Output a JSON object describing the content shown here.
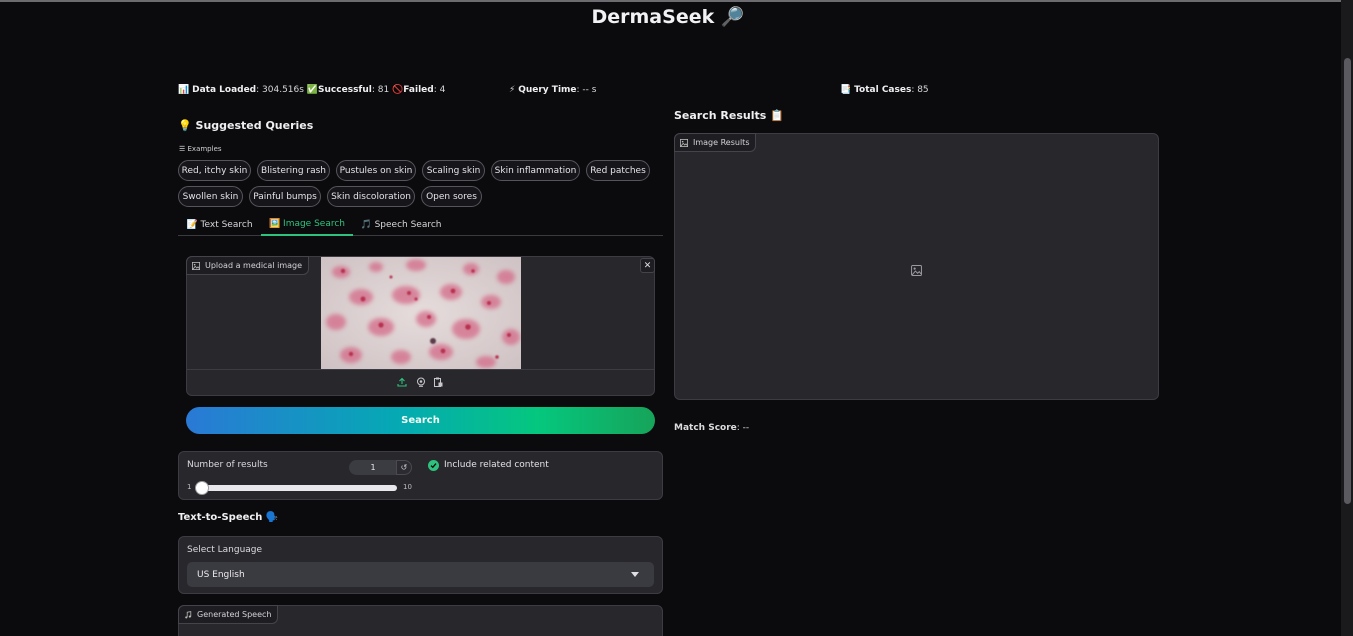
{
  "app": {
    "title": "DermaSeek 🔎"
  },
  "stats": {
    "data_loaded_label": "Data Loaded",
    "data_loaded_value": ": 304.516s",
    "successful_label": "Successful",
    "successful_value": ": 81",
    "failed_label": "Failed",
    "failed_value": ": 4",
    "query_time_label": "Query Time",
    "query_time_value": ": -- s",
    "total_cases_label": "Total Cases",
    "total_cases_value": ": 85",
    "icons": {
      "data_loaded": "📊",
      "successful": "✅",
      "failed": "🚫",
      "query_time": "⚡",
      "total_cases": "📑"
    }
  },
  "suggested": {
    "heading": "💡 Suggested Queries",
    "examples_label": "☰ Examples",
    "chips": [
      "Red, itchy skin",
      "Blistering rash",
      "Pustules on skin",
      "Scaling skin",
      "Skin inflammation",
      "Red patches",
      "Swollen skin",
      "Painful bumps",
      "Skin discoloration",
      "Open sores"
    ]
  },
  "tabs": [
    {
      "label": "📝 Text Search",
      "active": false
    },
    {
      "label": "🖼️ Image Search",
      "active": true
    },
    {
      "label": "🎵 Speech Search",
      "active": false
    }
  ],
  "upload": {
    "label": "Upload a medical image",
    "close": "✕"
  },
  "search_button": {
    "label": "Search"
  },
  "controls": {
    "num_results_label": "Number of results",
    "num_results_value": "1",
    "reset_symbol": "↺",
    "slider_min": "1",
    "slider_max": "10",
    "slider_fraction": 0,
    "include_related_label": "Include related content",
    "include_related_checked": true
  },
  "tts": {
    "heading": "Text-to-Speech 🗣️",
    "language_label": "Select Language",
    "language_value": "US English",
    "generated_label": "Generated Speech"
  },
  "results": {
    "heading": "Search Results 📋",
    "image_results_label": "Image Results",
    "match_score_label": "Match Score",
    "match_score_value": ": --"
  },
  "colors": {
    "accent_green": "#2ec27e",
    "gradient_start": "#2a79d6",
    "gradient_end": "#16a45a",
    "background": "#0b0b0d",
    "panel": "#27272c"
  }
}
